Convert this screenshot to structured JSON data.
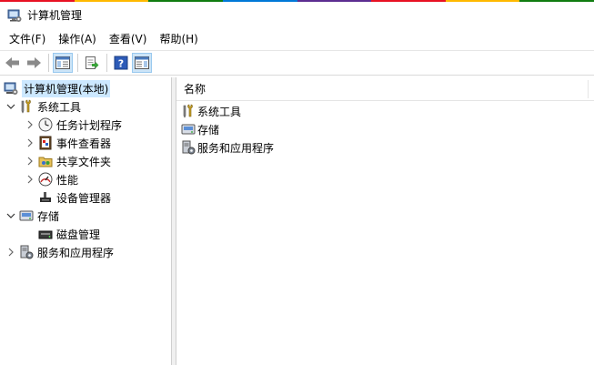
{
  "window": {
    "title": "计算机管理"
  },
  "accent_colors": [
    "#e81123",
    "#ffb900",
    "#107c10",
    "#0078d7",
    "#5c2d91",
    "#e81123",
    "#ffb900",
    "#107c10"
  ],
  "menu": [
    "文件(F)",
    "操作(A)",
    "查看(V)",
    "帮助(H)"
  ],
  "toolbar": {
    "buttons": [
      "back-arrow-icon",
      "forward-arrow-icon",
      "show-hide-tree-icon",
      "export-list-icon",
      "help-icon",
      "show-hide-action-pane-icon"
    ]
  },
  "tree": {
    "root": {
      "label": "计算机管理(本地)"
    },
    "system_tools": {
      "label": "系统工具",
      "children": [
        "任务计划程序",
        "事件查看器",
        "共享文件夹",
        "性能",
        "设备管理器"
      ]
    },
    "storage": {
      "label": "存储",
      "children": [
        "磁盘管理"
      ]
    },
    "services": {
      "label": "服务和应用程序"
    }
  },
  "details": {
    "column_name": "名称",
    "items": [
      "系统工具",
      "存储",
      "服务和应用程序"
    ]
  }
}
